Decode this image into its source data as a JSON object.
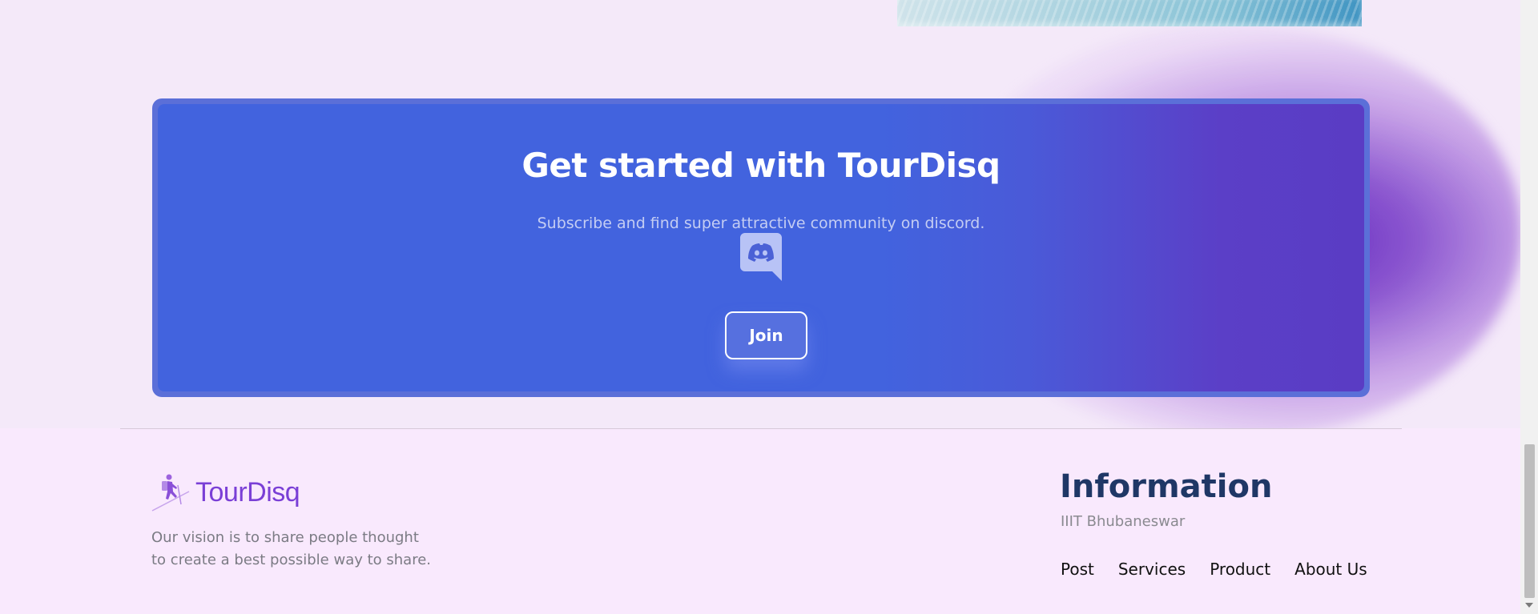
{
  "cta": {
    "title": "Get started with TourDisq",
    "subtitle": "Subscribe and find super attractive community on discord.",
    "icon": "discord-icon",
    "join_label": "Join"
  },
  "footer": {
    "brand_name": "TourDisq",
    "brand_icon": "hiker-icon",
    "vision_line1": "Our vision is to share people thought",
    "vision_line2": "to create a best possible way to share.",
    "info_title": "Information",
    "address": "IIIT Bhubaneswar",
    "nav": [
      {
        "label": "Post"
      },
      {
        "label": "Services"
      },
      {
        "label": "Product"
      },
      {
        "label": "About Us"
      }
    ]
  },
  "colors": {
    "cta_background": "#4263de",
    "glow": "#672cbe",
    "brand": "#7a3fd6",
    "info_title": "#1f3766"
  }
}
